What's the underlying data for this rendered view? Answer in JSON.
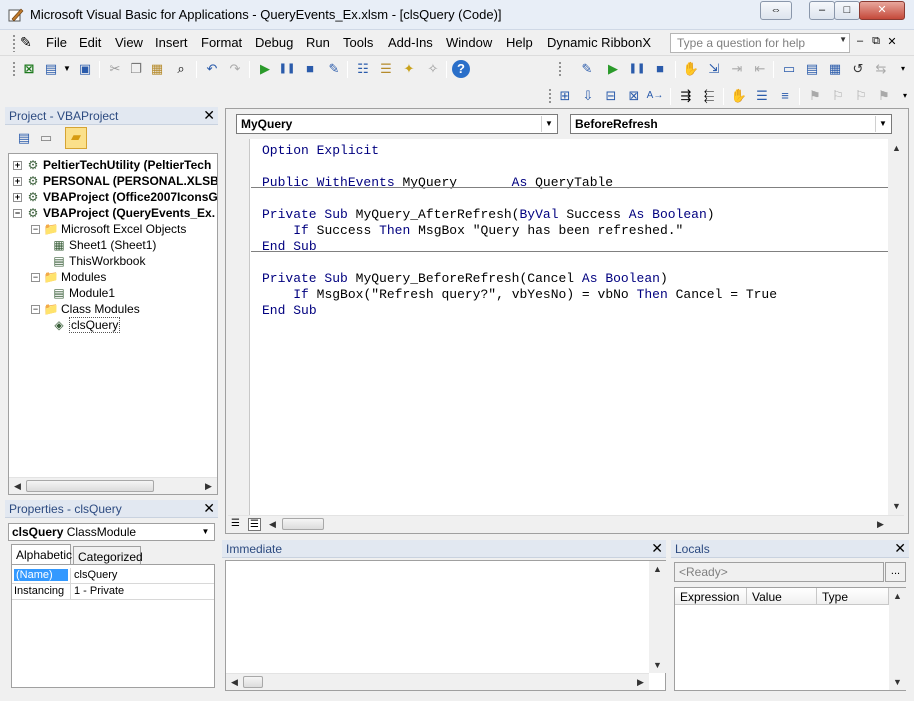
{
  "window": {
    "title": "Microsoft Visual Basic for Applications - QueryEvents_Ex.xlsm - [clsQuery (Code)]",
    "controls": [
      "⇔",
      "–",
      "□",
      "✕"
    ]
  },
  "menubar": {
    "items": [
      "File",
      "Edit",
      "View",
      "Insert",
      "Format",
      "Debug",
      "Run",
      "Tools",
      "Add-Ins",
      "Window",
      "Help",
      "Dynamic RibbonX"
    ],
    "help_placeholder": "Type a question for help",
    "mdi_controls": [
      "–",
      "⧉",
      "✕"
    ]
  },
  "project": {
    "title": "Project - VBAProject",
    "close": "✕",
    "tree": [
      {
        "label": "PeltierTechUtility (PeltierTech",
        "level": 0,
        "bold": true,
        "expander": "+"
      },
      {
        "label": "PERSONAL (PERSONAL.XLSB)",
        "level": 0,
        "bold": true,
        "expander": "+"
      },
      {
        "label": "VBAProject (Office2007IconsG",
        "level": 0,
        "bold": true,
        "expander": "+"
      },
      {
        "label": "VBAProject (QueryEvents_Ex.",
        "level": 0,
        "bold": true,
        "expander": "−"
      },
      {
        "label": "Microsoft Excel Objects",
        "level": 1,
        "bold": false,
        "expander": "−"
      },
      {
        "label": "Sheet1 (Sheet1)",
        "level": 2,
        "bold": false,
        "expander": ""
      },
      {
        "label": "ThisWorkbook",
        "level": 2,
        "bold": false,
        "expander": ""
      },
      {
        "label": "Modules",
        "level": 1,
        "bold": false,
        "expander": "−"
      },
      {
        "label": "Module1",
        "level": 2,
        "bold": false,
        "expander": ""
      },
      {
        "label": "Class Modules",
        "level": 1,
        "bold": false,
        "expander": "−"
      },
      {
        "label": "clsQuery",
        "level": 2,
        "bold": false,
        "expander": "",
        "selected": true
      }
    ]
  },
  "properties": {
    "title": "Properties - clsQuery",
    "close": "✕",
    "object_name": "clsQuery",
    "object_type": "ClassModule",
    "tabs": [
      "Alphabetic",
      "Categorized"
    ],
    "rows": [
      {
        "name": "(Name)",
        "value": "clsQuery"
      },
      {
        "name": "Instancing",
        "value": "1 - Private"
      }
    ]
  },
  "code": {
    "object_combo": "MyQuery",
    "procedure_combo": "BeforeRefresh",
    "lines": [
      "Option Explicit",
      "",
      "Public WithEvents MyQuery       As QueryTable",
      "",
      "Private Sub MyQuery_AfterRefresh(ByVal Success As Boolean)",
      "    If Success Then MsgBox \"Query has been refreshed.\"",
      "End Sub",
      "",
      "Private Sub MyQuery_BeforeRefresh(Cancel As Boolean)",
      "    If MsgBox(\"Refresh query?\", vbYesNo) = vbNo Then Cancel = True",
      "End Sub"
    ]
  },
  "immediate": {
    "title": "Immediate",
    "close": "✕"
  },
  "locals": {
    "title": "Locals",
    "close": "✕",
    "status": "<Ready>",
    "more": "...",
    "columns": [
      "Expression",
      "Value",
      "Type"
    ]
  },
  "colors": {
    "keyword": "#00007f",
    "panel_header": "#e2e8f1",
    "selection": "#3399ff"
  }
}
